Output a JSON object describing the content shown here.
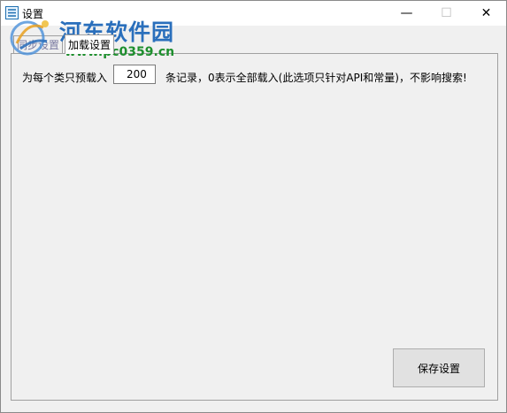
{
  "window": {
    "title": "设置",
    "controls": {
      "minimize": "—",
      "maximize": "☐",
      "close": "✕"
    }
  },
  "watermark": {
    "site_name": "河东软件园",
    "url": "www.pc0359.cn"
  },
  "tabs": [
    {
      "label": "同步设置",
      "selected": false
    },
    {
      "label": "加载设置",
      "selected": true
    }
  ],
  "load_settings": {
    "prefix_label": "为每个类只预载入",
    "count_value": "200",
    "suffix_label": "条记录，0表示全部载入(此选项只针对API和常量)，不影响搜索!"
  },
  "buttons": {
    "save": "保存设置"
  },
  "colors": {
    "watermark_blue": "#2a6fbc",
    "watermark_green": "#1e8f2e"
  }
}
